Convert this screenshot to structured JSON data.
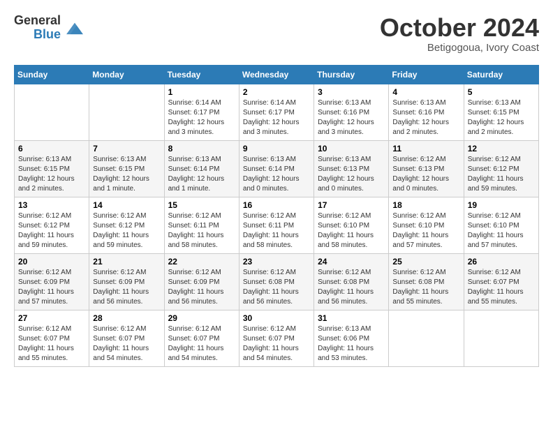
{
  "logo": {
    "general": "General",
    "blue": "Blue"
  },
  "title": "October 2024",
  "subtitle": "Betigogoua, Ivory Coast",
  "days_of_week": [
    "Sunday",
    "Monday",
    "Tuesday",
    "Wednesday",
    "Thursday",
    "Friday",
    "Saturday"
  ],
  "weeks": [
    [
      {
        "day": "",
        "info": ""
      },
      {
        "day": "",
        "info": ""
      },
      {
        "day": "1",
        "info": "Sunrise: 6:14 AM\nSunset: 6:17 PM\nDaylight: 12 hours and 3 minutes."
      },
      {
        "day": "2",
        "info": "Sunrise: 6:14 AM\nSunset: 6:17 PM\nDaylight: 12 hours and 3 minutes."
      },
      {
        "day": "3",
        "info": "Sunrise: 6:13 AM\nSunset: 6:16 PM\nDaylight: 12 hours and 3 minutes."
      },
      {
        "day": "4",
        "info": "Sunrise: 6:13 AM\nSunset: 6:16 PM\nDaylight: 12 hours and 2 minutes."
      },
      {
        "day": "5",
        "info": "Sunrise: 6:13 AM\nSunset: 6:15 PM\nDaylight: 12 hours and 2 minutes."
      }
    ],
    [
      {
        "day": "6",
        "info": "Sunrise: 6:13 AM\nSunset: 6:15 PM\nDaylight: 12 hours and 2 minutes."
      },
      {
        "day": "7",
        "info": "Sunrise: 6:13 AM\nSunset: 6:15 PM\nDaylight: 12 hours and 1 minute."
      },
      {
        "day": "8",
        "info": "Sunrise: 6:13 AM\nSunset: 6:14 PM\nDaylight: 12 hours and 1 minute."
      },
      {
        "day": "9",
        "info": "Sunrise: 6:13 AM\nSunset: 6:14 PM\nDaylight: 12 hours and 0 minutes."
      },
      {
        "day": "10",
        "info": "Sunrise: 6:13 AM\nSunset: 6:13 PM\nDaylight: 12 hours and 0 minutes."
      },
      {
        "day": "11",
        "info": "Sunrise: 6:12 AM\nSunset: 6:13 PM\nDaylight: 12 hours and 0 minutes."
      },
      {
        "day": "12",
        "info": "Sunrise: 6:12 AM\nSunset: 6:12 PM\nDaylight: 11 hours and 59 minutes."
      }
    ],
    [
      {
        "day": "13",
        "info": "Sunrise: 6:12 AM\nSunset: 6:12 PM\nDaylight: 11 hours and 59 minutes."
      },
      {
        "day": "14",
        "info": "Sunrise: 6:12 AM\nSunset: 6:12 PM\nDaylight: 11 hours and 59 minutes."
      },
      {
        "day": "15",
        "info": "Sunrise: 6:12 AM\nSunset: 6:11 PM\nDaylight: 11 hours and 58 minutes."
      },
      {
        "day": "16",
        "info": "Sunrise: 6:12 AM\nSunset: 6:11 PM\nDaylight: 11 hours and 58 minutes."
      },
      {
        "day": "17",
        "info": "Sunrise: 6:12 AM\nSunset: 6:10 PM\nDaylight: 11 hours and 58 minutes."
      },
      {
        "day": "18",
        "info": "Sunrise: 6:12 AM\nSunset: 6:10 PM\nDaylight: 11 hours and 57 minutes."
      },
      {
        "day": "19",
        "info": "Sunrise: 6:12 AM\nSunset: 6:10 PM\nDaylight: 11 hours and 57 minutes."
      }
    ],
    [
      {
        "day": "20",
        "info": "Sunrise: 6:12 AM\nSunset: 6:09 PM\nDaylight: 11 hours and 57 minutes."
      },
      {
        "day": "21",
        "info": "Sunrise: 6:12 AM\nSunset: 6:09 PM\nDaylight: 11 hours and 56 minutes."
      },
      {
        "day": "22",
        "info": "Sunrise: 6:12 AM\nSunset: 6:09 PM\nDaylight: 11 hours and 56 minutes."
      },
      {
        "day": "23",
        "info": "Sunrise: 6:12 AM\nSunset: 6:08 PM\nDaylight: 11 hours and 56 minutes."
      },
      {
        "day": "24",
        "info": "Sunrise: 6:12 AM\nSunset: 6:08 PM\nDaylight: 11 hours and 56 minutes."
      },
      {
        "day": "25",
        "info": "Sunrise: 6:12 AM\nSunset: 6:08 PM\nDaylight: 11 hours and 55 minutes."
      },
      {
        "day": "26",
        "info": "Sunrise: 6:12 AM\nSunset: 6:07 PM\nDaylight: 11 hours and 55 minutes."
      }
    ],
    [
      {
        "day": "27",
        "info": "Sunrise: 6:12 AM\nSunset: 6:07 PM\nDaylight: 11 hours and 55 minutes."
      },
      {
        "day": "28",
        "info": "Sunrise: 6:12 AM\nSunset: 6:07 PM\nDaylight: 11 hours and 54 minutes."
      },
      {
        "day": "29",
        "info": "Sunrise: 6:12 AM\nSunset: 6:07 PM\nDaylight: 11 hours and 54 minutes."
      },
      {
        "day": "30",
        "info": "Sunrise: 6:12 AM\nSunset: 6:07 PM\nDaylight: 11 hours and 54 minutes."
      },
      {
        "day": "31",
        "info": "Sunrise: 6:13 AM\nSunset: 6:06 PM\nDaylight: 11 hours and 53 minutes."
      },
      {
        "day": "",
        "info": ""
      },
      {
        "day": "",
        "info": ""
      }
    ]
  ]
}
